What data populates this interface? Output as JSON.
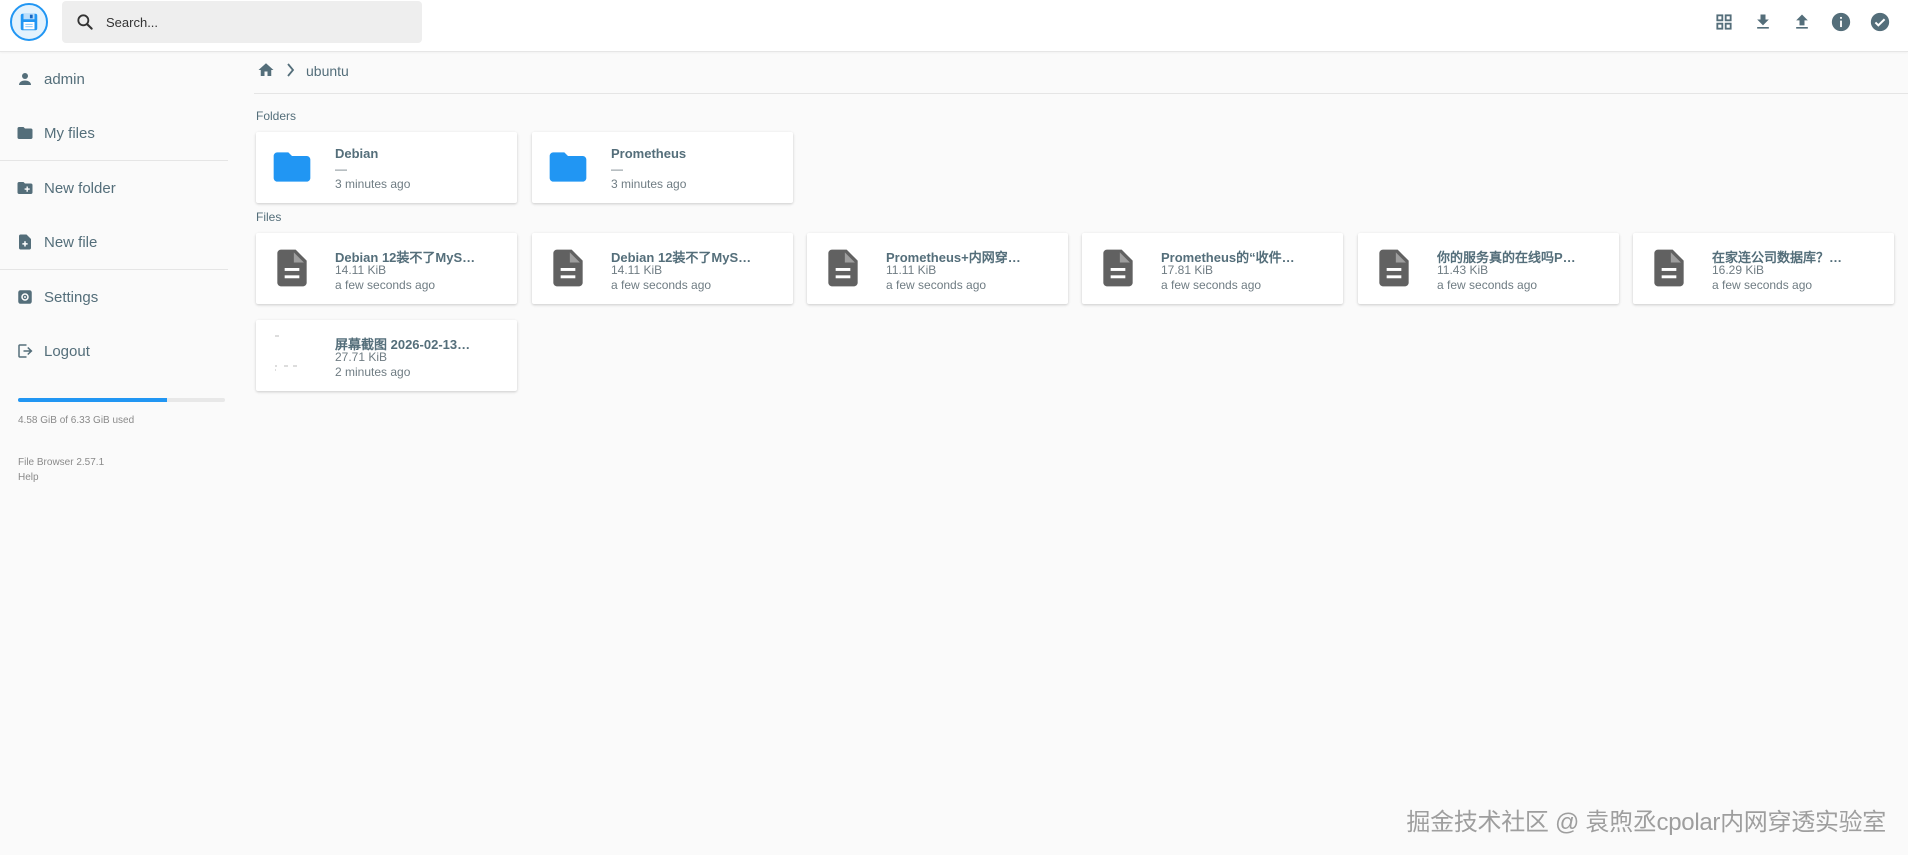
{
  "colors": {
    "accent": "#2196f3",
    "folder_icon": "#2196f3",
    "file_icon": "#616161",
    "text": "#546e7a"
  },
  "header": {
    "logo_icon": "floppy-disk-icon",
    "search_placeholder": "Search...",
    "actions": [
      {
        "name": "view-mode-button",
        "icon": "grid-icon"
      },
      {
        "name": "download-button",
        "icon": "download-icon"
      },
      {
        "name": "upload-button",
        "icon": "upload-icon"
      },
      {
        "name": "info-button",
        "icon": "info-icon"
      },
      {
        "name": "select-button",
        "icon": "check-circle-icon"
      }
    ]
  },
  "sidebar": {
    "items": [
      {
        "label": "admin",
        "icon": "person-icon"
      },
      {
        "label": "My files",
        "icon": "folder-icon"
      },
      {
        "label": "New folder",
        "icon": "create-new-folder-icon"
      },
      {
        "label": "New file",
        "icon": "note-add-icon"
      },
      {
        "label": "Settings",
        "icon": "settings-icon"
      },
      {
        "label": "Logout",
        "icon": "logout-icon"
      }
    ],
    "quota": {
      "text": "4.58 GiB of 6.33 GiB used",
      "fraction": 0.72
    },
    "version": "File Browser 2.57.1",
    "help": "Help"
  },
  "breadcrumb": {
    "home_icon": "home-icon",
    "separator_icon": "chevron-right-icon",
    "current": "ubuntu"
  },
  "main": {
    "folders_title": "Folders",
    "files_title": "Files",
    "folders": [
      {
        "name": "Debian",
        "size": "—",
        "modified": "3 minutes ago"
      },
      {
        "name": "Prometheus",
        "size": "—",
        "modified": "3 minutes ago"
      }
    ],
    "files": [
      {
        "name": "Debian 12装不了MyS…",
        "size": "14.11 KiB",
        "modified": "a few seconds ago",
        "icon": "file-icon"
      },
      {
        "name": "Debian 12装不了MyS…",
        "size": "14.11 KiB",
        "modified": "a few seconds ago",
        "icon": "file-icon"
      },
      {
        "name": "Prometheus+内网穿…",
        "size": "11.11 KiB",
        "modified": "a few seconds ago",
        "icon": "file-icon"
      },
      {
        "name": "Prometheus的“收件…",
        "size": "17.81 KiB",
        "modified": "a few seconds ago",
        "icon": "file-icon"
      },
      {
        "name": "你的服务真的在线吗P…",
        "size": "11.43 KiB",
        "modified": "a few seconds ago",
        "icon": "file-icon"
      },
      {
        "name": "在家连公司数据库？…",
        "size": "16.29 KiB",
        "modified": "a few seconds ago",
        "icon": "file-icon"
      },
      {
        "name": "屏幕截图 2026-02-13…",
        "size": "27.71 KiB",
        "modified": "2 minutes ago",
        "icon": "image-thumbnail"
      }
    ]
  },
  "watermark": "掘金技术社区 @ 袁煦丞cpolar内网穿透实验室"
}
